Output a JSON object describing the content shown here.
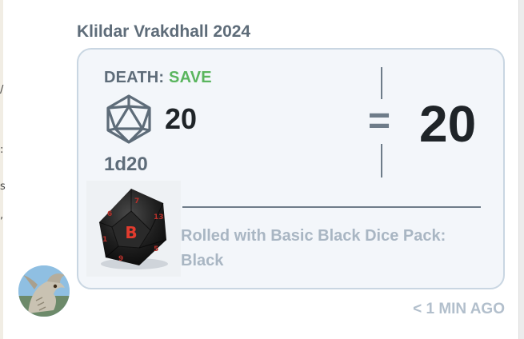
{
  "message": {
    "author": "Klildar Vrakdhall 2024",
    "timestamp": "< 1 MIN AGO"
  },
  "roll": {
    "type_label": "DEATH",
    "type_separator": ":",
    "result_label": "SAVE",
    "die_value": "20",
    "notation": "1d20",
    "equals": "=",
    "total": "20",
    "dice_pack": "Rolled with Basic Black Dice Pack: Black",
    "die_icon": "d20-icon",
    "die_face_letter": "B"
  },
  "colors": {
    "result_green": "#5ab55e",
    "label_gray": "#5e6c79",
    "card_border": "#c9d6e2",
    "card_bg": "#f3f6fa",
    "die_red": "#e23b2e"
  }
}
